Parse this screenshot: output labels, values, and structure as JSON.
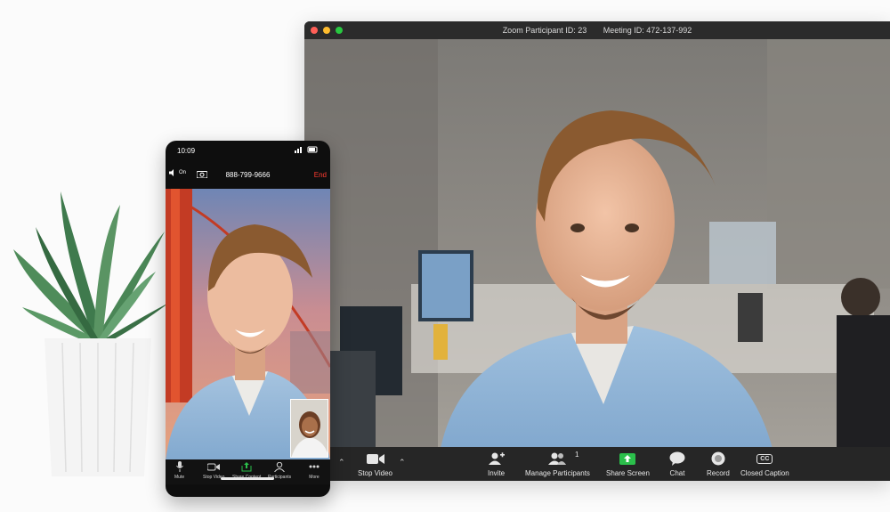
{
  "window": {
    "title_participant": "Zoom Participant ID: 23",
    "title_meeting": "Meeting ID: 472-137-992",
    "traffic_lights": [
      "#ff5f57",
      "#febc2e",
      "#28c840"
    ]
  },
  "toolbar": {
    "stop_video": "Stop Video",
    "invite": "Invite",
    "manage_participants": "Manage Participants",
    "participant_count": "1",
    "share_screen": "Share Screen",
    "chat": "Chat",
    "record": "Record",
    "closed_caption": "Closed Caption",
    "closed_caption_badge": "CC",
    "share_color": "#2bbf4b"
  },
  "phone": {
    "time": "10:09",
    "phone_number": "888-799-9666",
    "end_label": "End",
    "speaker_label": "On",
    "buttons": {
      "mute": "Mute",
      "stop_video": "Stop Video",
      "share_content": "Share Content",
      "participants": "Participants",
      "more": "More"
    }
  },
  "icons": [
    "mute-icon",
    "video-camera-icon",
    "invite-icon",
    "participants-icon",
    "share-screen-icon",
    "chat-icon",
    "record-icon",
    "closed-caption-icon",
    "speaker-icon",
    "camera-switch-icon",
    "more-icon",
    "caret-up-icon"
  ]
}
